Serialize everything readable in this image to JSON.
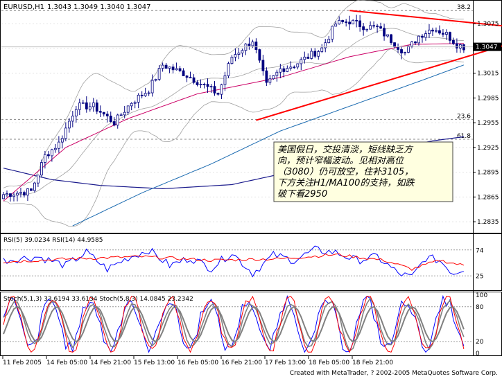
{
  "header": {
    "symbol": "EURUSD,H1",
    "ohlc": "1.3043 1.3049 1.3040 1.3047"
  },
  "footer": {
    "copyright": "Created with MetaTrader, ? 2002-2005 MetaQuotes Software Corp."
  },
  "annotation": {
    "lines": [
      "美国假日，交投清淡，短线缺乏方",
      "向，预计窄幅波动。见相对高位",
      "（3080）仍可放空，住补3105，",
      "下方关注H1/MA100的支持，如跌",
      "破下看2950"
    ]
  },
  "colors": {
    "background": "#ffffff",
    "candle": "#000080",
    "ma_magenta": "#cc0066",
    "ma_blue": "#1a6ab0",
    "ma_navy": "#1a1a8c",
    "bollinger": "#a0a0a0",
    "trendline": "#ff0000",
    "rsi_fast": "#0000ff",
    "rsi_slow": "#ff0000",
    "stoch_gray": "#808080",
    "annotation_bg": "#ffffe0"
  },
  "chart_data": [
    {
      "type": "candlestick",
      "name": "price",
      "y_ticks": [
        "1.3075",
        "1.3045",
        "1.3015",
        "1.2985",
        "1.2955",
        "1.2925",
        "1.2895",
        "1.2865",
        "1.2835"
      ],
      "ylim": [
        1.2825,
        1.3092
      ],
      "current_price": "1.3047",
      "fib_labels": [
        {
          "label": "38.2",
          "price": 1.3091
        },
        {
          "label": "23.6",
          "price": 1.2959
        },
        {
          "label": "61.8",
          "price": 1.2935
        }
      ],
      "x_ticks": [
        "11 Feb 2005",
        "14 Feb 05:00",
        "14 Feb 21:00",
        "15 Feb 13:00",
        "16 Feb 05:00",
        "16 Feb 21:00",
        "17 Feb 13:00",
        "18 Feb 05:00",
        "18 Feb 21:00"
      ],
      "close_anchors": [
        {
          "bar": 0,
          "price": 1.2868
        },
        {
          "bar": 8,
          "price": 1.2872
        },
        {
          "bar": 12,
          "price": 1.2915
        },
        {
          "bar": 16,
          "price": 1.293
        },
        {
          "bar": 21,
          "price": 1.2975
        },
        {
          "bar": 26,
          "price": 1.2975
        },
        {
          "bar": 32,
          "price": 1.2955
        },
        {
          "bar": 37,
          "price": 1.298
        },
        {
          "bar": 42,
          "price": 1.2995
        },
        {
          "bar": 46,
          "price": 1.3025
        },
        {
          "bar": 52,
          "price": 1.3015
        },
        {
          "bar": 58,
          "price": 1.3
        },
        {
          "bar": 62,
          "price": 1.299
        },
        {
          "bar": 66,
          "price": 1.3035
        },
        {
          "bar": 72,
          "price": 1.3055
        },
        {
          "bar": 76,
          "price": 1.3
        },
        {
          "bar": 80,
          "price": 1.302
        },
        {
          "bar": 84,
          "price": 1.3025
        },
        {
          "bar": 88,
          "price": 1.3035
        },
        {
          "bar": 92,
          "price": 1.3045
        },
        {
          "bar": 96,
          "price": 1.3075
        },
        {
          "bar": 100,
          "price": 1.3078
        },
        {
          "bar": 104,
          "price": 1.3072
        },
        {
          "bar": 108,
          "price": 1.307
        },
        {
          "bar": 112,
          "price": 1.3055
        },
        {
          "bar": 116,
          "price": 1.304
        },
        {
          "bar": 120,
          "price": 1.306
        },
        {
          "bar": 124,
          "price": 1.307
        },
        {
          "bar": 128,
          "price": 1.3062
        },
        {
          "bar": 131,
          "price": 1.305
        },
        {
          "bar": 133,
          "price": 1.3047
        }
      ],
      "ma_magenta": [
        {
          "bar": 0,
          "price": 1.286
        },
        {
          "bar": 18,
          "price": 1.2925
        },
        {
          "bar": 36,
          "price": 1.296
        },
        {
          "bar": 56,
          "price": 1.299
        },
        {
          "bar": 80,
          "price": 1.301
        },
        {
          "bar": 100,
          "price": 1.3035
        },
        {
          "bar": 118,
          "price": 1.305
        },
        {
          "bar": 133,
          "price": 1.3051
        }
      ],
      "ma_blue": [
        {
          "bar": 20,
          "price": 1.283
        },
        {
          "bar": 40,
          "price": 1.287
        },
        {
          "bar": 60,
          "price": 1.2905
        },
        {
          "bar": 80,
          "price": 1.2945
        },
        {
          "bar": 100,
          "price": 1.2975
        },
        {
          "bar": 120,
          "price": 1.3005
        },
        {
          "bar": 133,
          "price": 1.3025
        }
      ],
      "ma_navy": [
        {
          "bar": 0,
          "price": 1.29
        },
        {
          "bar": 14,
          "price": 1.2886
        },
        {
          "bar": 28,
          "price": 1.2879
        },
        {
          "bar": 46,
          "price": 1.2875
        },
        {
          "bar": 66,
          "price": 1.288
        },
        {
          "bar": 88,
          "price": 1.29
        },
        {
          "bar": 108,
          "price": 1.292
        },
        {
          "bar": 124,
          "price": 1.2933
        },
        {
          "bar": 133,
          "price": 1.2938
        }
      ],
      "trendlines": [
        {
          "from": {
            "bar": 73,
            "price": 1.2958
          },
          "to": {
            "bar": 148,
            "price": 1.3053
          }
        },
        {
          "from": {
            "bar": 100,
            "price": 1.3091
          },
          "to": {
            "bar": 150,
            "price": 1.307
          }
        }
      ]
    },
    {
      "type": "line",
      "name": "RSI",
      "label": "RSI(5) 39.0234 RSI(14) 44.9585",
      "ylim": [
        0,
        100
      ],
      "levels": [
        75,
        25
      ],
      "y_ticks": [
        "74",
        "25"
      ],
      "series": [
        {
          "name": "RSI(5)",
          "last": 39.0234,
          "anchors": [
            {
              "bar": 0,
              "v": 55
            },
            {
              "bar": 10,
              "v": 62
            },
            {
              "bar": 18,
              "v": 45
            },
            {
              "bar": 24,
              "v": 70
            },
            {
              "bar": 30,
              "v": 38
            },
            {
              "bar": 36,
              "v": 60
            },
            {
              "bar": 42,
              "v": 75
            },
            {
              "bar": 48,
              "v": 45
            },
            {
              "bar": 54,
              "v": 60
            },
            {
              "bar": 60,
              "v": 40
            },
            {
              "bar": 66,
              "v": 70
            },
            {
              "bar": 72,
              "v": 30
            },
            {
              "bar": 78,
              "v": 65
            },
            {
              "bar": 84,
              "v": 55
            },
            {
              "bar": 90,
              "v": 75
            },
            {
              "bar": 96,
              "v": 70
            },
            {
              "bar": 102,
              "v": 55
            },
            {
              "bar": 108,
              "v": 62
            },
            {
              "bar": 114,
              "v": 30
            },
            {
              "bar": 118,
              "v": 22
            },
            {
              "bar": 122,
              "v": 60
            },
            {
              "bar": 126,
              "v": 55
            },
            {
              "bar": 130,
              "v": 30
            },
            {
              "bar": 133,
              "v": 39
            }
          ]
        },
        {
          "name": "RSI(14)",
          "last": 44.9585,
          "anchors": [
            {
              "bar": 0,
              "v": 52
            },
            {
              "bar": 20,
              "v": 58
            },
            {
              "bar": 40,
              "v": 62
            },
            {
              "bar": 60,
              "v": 55
            },
            {
              "bar": 80,
              "v": 58
            },
            {
              "bar": 96,
              "v": 66
            },
            {
              "bar": 110,
              "v": 55
            },
            {
              "bar": 118,
              "v": 38
            },
            {
              "bar": 126,
              "v": 55
            },
            {
              "bar": 133,
              "v": 45
            }
          ]
        }
      ]
    },
    {
      "type": "line",
      "name": "Stochastic",
      "label": "Stoch(5,1,3) 33.6194 33.6134 Stoch(5,8,3) 14.0845 23.2342",
      "ylim": [
        0,
        100
      ],
      "levels": [
        80,
        20
      ],
      "y_ticks": [
        "100",
        "80",
        "20",
        "0"
      ],
      "series": [
        {
          "name": "Stoch(5,1,3) %K",
          "color": "blue",
          "last": 33.6194
        },
        {
          "name": "Stoch(5,1,3) %D",
          "color": "gray",
          "last": 33.6134
        },
        {
          "name": "Stoch(5,8,3) %K",
          "color": "red",
          "last": 14.0845
        },
        {
          "name": "Stoch(5,8,3) %D",
          "color": "gray",
          "last": 23.2342
        }
      ]
    }
  ]
}
